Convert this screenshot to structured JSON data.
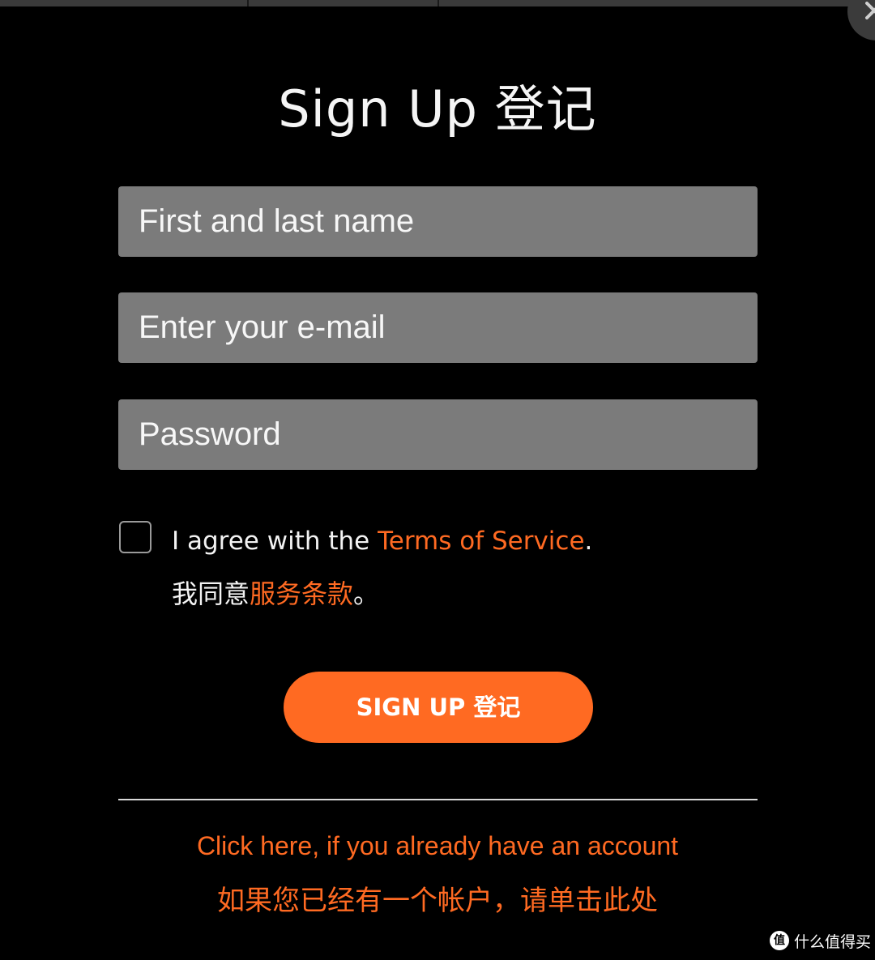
{
  "header": {
    "title": "Sign Up  登记"
  },
  "form": {
    "name_placeholder": "First and last name",
    "email_placeholder": "Enter your e-mail",
    "password_placeholder": "Password",
    "agree_prefix": "I agree with the ",
    "agree_link": "Terms of Service",
    "agree_suffix": ".",
    "agree_zh_prefix": "我同意",
    "agree_zh_link": "服务条款",
    "agree_zh_suffix": "。",
    "agree_checked": false,
    "submit_label": "SIGN UP  登记"
  },
  "footer": {
    "login_en": "Click here, if you already have an account",
    "login_zh": "如果您已经有一个帐户，请单击此处"
  },
  "watermark": {
    "logo_glyph": "值",
    "text": "什么值得买"
  },
  "colors": {
    "accent": "#ff6a22",
    "background": "#000000",
    "field_bg": "#7b7b7b"
  },
  "icons": {
    "close": "close-icon"
  }
}
